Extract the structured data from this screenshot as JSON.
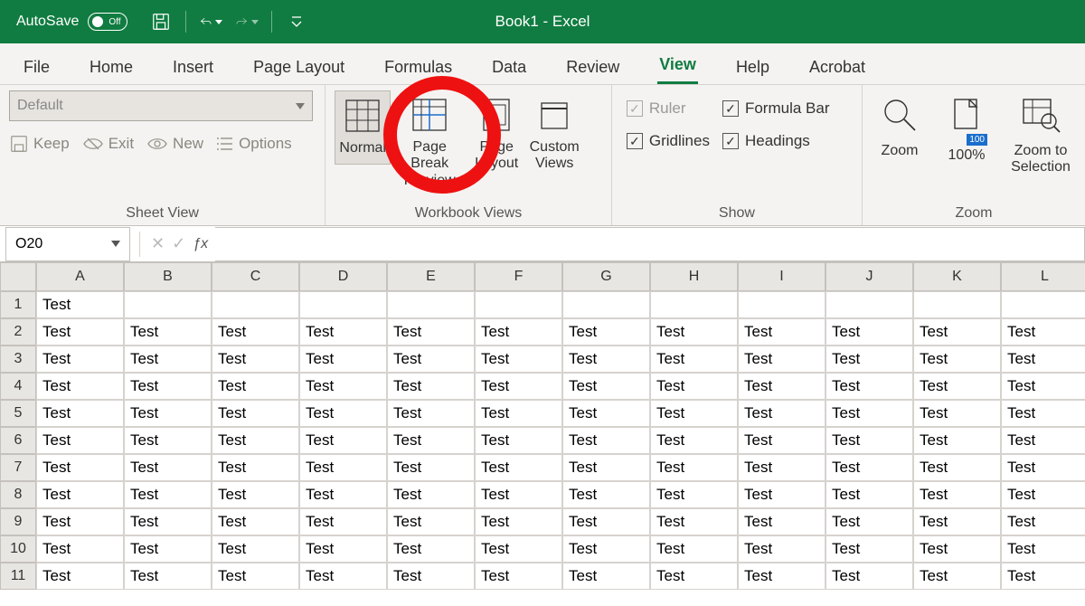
{
  "title": {
    "name": "Book1",
    "suffix": " -  Excel"
  },
  "autosave": {
    "label": "AutoSave",
    "state": "Off"
  },
  "tabs": [
    "File",
    "Home",
    "Insert",
    "Page Layout",
    "Formulas",
    "Data",
    "Review",
    "View",
    "Help",
    "Acrobat"
  ],
  "active_tab": "View",
  "groups": {
    "sheet_view": {
      "label": "Sheet View",
      "dropdown": "Default",
      "buttons": {
        "keep": "Keep",
        "exit": "Exit",
        "new": "New",
        "options": "Options"
      }
    },
    "workbook_views": {
      "label": "Workbook Views",
      "normal": "Normal",
      "page_break1": "Page Break",
      "page_break2": "Preview",
      "page_layout1": "Page",
      "page_layout2": "Layout",
      "custom1": "Custom",
      "custom2": "Views"
    },
    "show": {
      "label": "Show",
      "ruler": "Ruler",
      "formula_bar": "Formula Bar",
      "gridlines": "Gridlines",
      "headings": "Headings"
    },
    "zoom": {
      "label": "Zoom",
      "zoom": "Zoom",
      "hundred": "100%",
      "to_sel1": "Zoom to",
      "to_sel2": "Selection",
      "badge": "100"
    }
  },
  "namebox": "O20",
  "formula": "",
  "columns": [
    "A",
    "B",
    "C",
    "D",
    "E",
    "F",
    "G",
    "H",
    "I",
    "J",
    "K",
    "L"
  ],
  "rows": [
    {
      "n": "1",
      "cells": [
        "Test",
        "",
        "",
        "",
        "",
        "",
        "",
        "",
        "",
        "",
        "",
        ""
      ]
    },
    {
      "n": "2",
      "cells": [
        "Test",
        "Test",
        "Test",
        "Test",
        "Test",
        "Test",
        "Test",
        "Test",
        "Test",
        "Test",
        "Test",
        "Test"
      ]
    },
    {
      "n": "3",
      "cells": [
        "Test",
        "Test",
        "Test",
        "Test",
        "Test",
        "Test",
        "Test",
        "Test",
        "Test",
        "Test",
        "Test",
        "Test"
      ]
    },
    {
      "n": "4",
      "cells": [
        "Test",
        "Test",
        "Test",
        "Test",
        "Test",
        "Test",
        "Test",
        "Test",
        "Test",
        "Test",
        "Test",
        "Test"
      ]
    },
    {
      "n": "5",
      "cells": [
        "Test",
        "Test",
        "Test",
        "Test",
        "Test",
        "Test",
        "Test",
        "Test",
        "Test",
        "Test",
        "Test",
        "Test"
      ]
    },
    {
      "n": "6",
      "cells": [
        "Test",
        "Test",
        "Test",
        "Test",
        "Test",
        "Test",
        "Test",
        "Test",
        "Test",
        "Test",
        "Test",
        "Test"
      ]
    },
    {
      "n": "7",
      "cells": [
        "Test",
        "Test",
        "Test",
        "Test",
        "Test",
        "Test",
        "Test",
        "Test",
        "Test",
        "Test",
        "Test",
        "Test"
      ]
    },
    {
      "n": "8",
      "cells": [
        "Test",
        "Test",
        "Test",
        "Test",
        "Test",
        "Test",
        "Test",
        "Test",
        "Test",
        "Test",
        "Test",
        "Test"
      ]
    },
    {
      "n": "9",
      "cells": [
        "Test",
        "Test",
        "Test",
        "Test",
        "Test",
        "Test",
        "Test",
        "Test",
        "Test",
        "Test",
        "Test",
        "Test"
      ]
    },
    {
      "n": "10",
      "cells": [
        "Test",
        "Test",
        "Test",
        "Test",
        "Test",
        "Test",
        "Test",
        "Test",
        "Test",
        "Test",
        "Test",
        "Test"
      ]
    },
    {
      "n": "11",
      "cells": [
        "Test",
        "Test",
        "Test",
        "Test",
        "Test",
        "Test",
        "Test",
        "Test",
        "Test",
        "Test",
        "Test",
        "Test"
      ]
    }
  ]
}
